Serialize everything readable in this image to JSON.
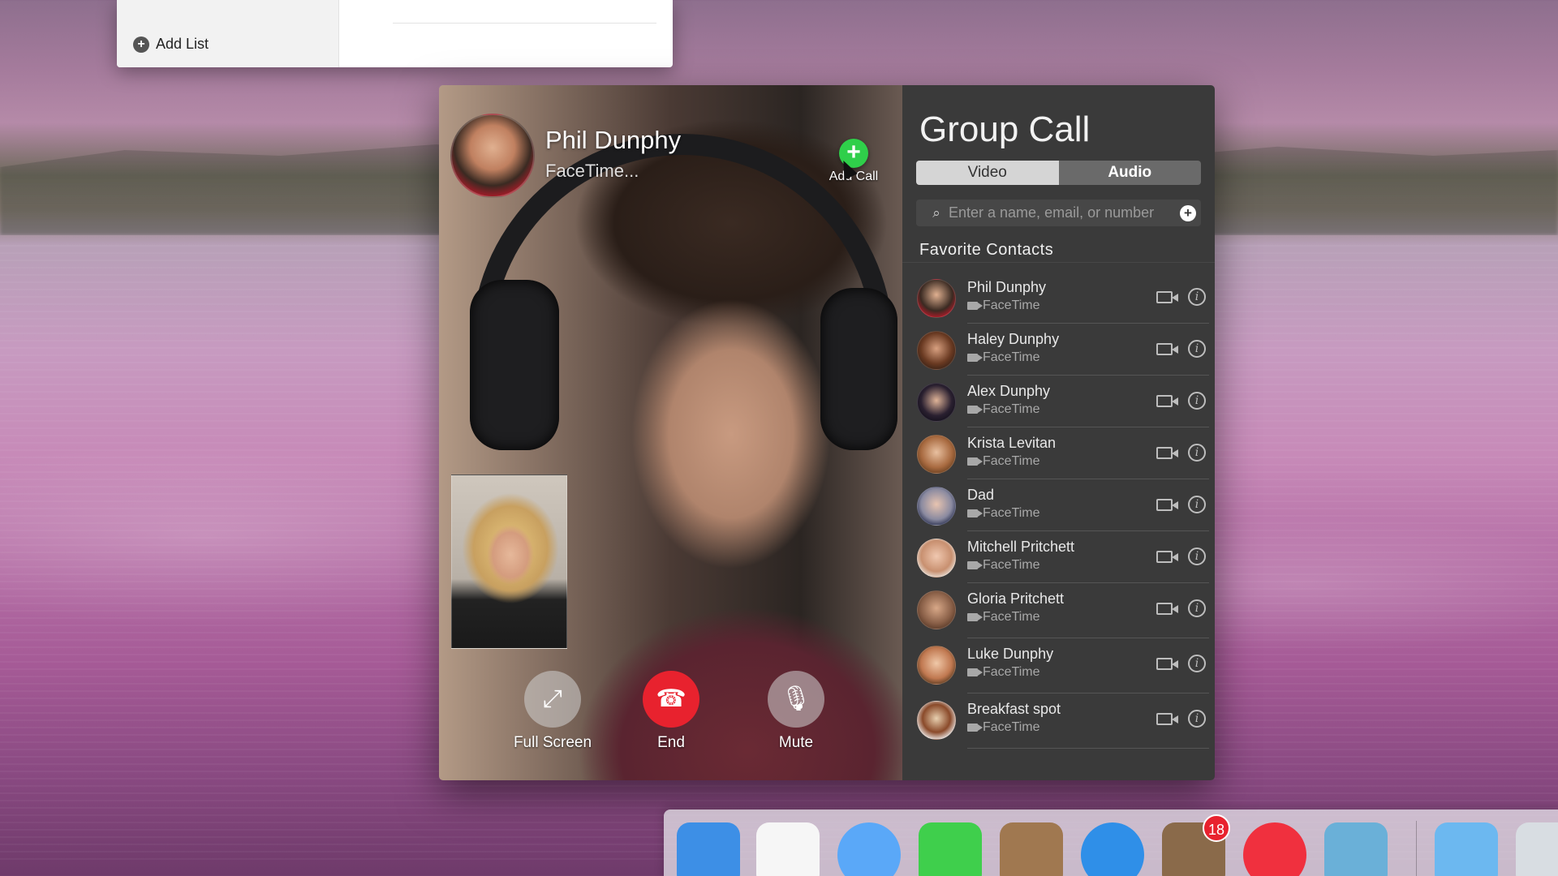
{
  "reminders": {
    "add_list_label": "Add List"
  },
  "call": {
    "caller_name": "Phil Dunphy",
    "caller_status": "FaceTime...",
    "add_call_label": "Add Call",
    "controls": {
      "fullscreen_label": "Full Screen",
      "end_label": "End",
      "mute_label": "Mute"
    }
  },
  "group_call": {
    "title": "Group Call",
    "segments": {
      "video": "Video",
      "audio": "Audio",
      "selected": "Audio"
    },
    "search_placeholder": "Enter a name, email, or number",
    "favorites_title": "Favorite Contacts",
    "contacts": [
      {
        "name": "Phil Dunphy",
        "sub": "FaceTime"
      },
      {
        "name": "Haley Dunphy",
        "sub": "FaceTime"
      },
      {
        "name": "Alex Dunphy",
        "sub": "FaceTime"
      },
      {
        "name": "Krista Levitan",
        "sub": "FaceTime"
      },
      {
        "name": "Dad",
        "sub": "FaceTime"
      },
      {
        "name": "Mitchell Pritchett",
        "sub": "FaceTime"
      },
      {
        "name": "Gloria Pritchett",
        "sub": "FaceTime"
      },
      {
        "name": "Luke Dunphy",
        "sub": "FaceTime"
      },
      {
        "name": "Breakfast spot",
        "sub": "FaceTime"
      }
    ]
  },
  "dock": {
    "items": [
      {
        "name": "finder-icon",
        "color": "#3d8fe6"
      },
      {
        "name": "reminders-icon",
        "color": "#f6f6f6"
      },
      {
        "name": "messages-icon",
        "color": "#5aa8f8"
      },
      {
        "name": "facetime-icon",
        "color": "#3fcf4c"
      },
      {
        "name": "contacts-icon",
        "color": "#a07850"
      },
      {
        "name": "safari-icon",
        "color": "#2f8fe8"
      },
      {
        "name": "mail-icon",
        "color": "#8a6a4a",
        "badge": "18"
      },
      {
        "name": "itunes-icon",
        "color": "#f0303e"
      },
      {
        "name": "photos-icon",
        "color": "#6ab0d8"
      },
      {
        "name": "folder-icon",
        "color": "#6cb8f0"
      },
      {
        "name": "trash-icon",
        "color": "#d8dde2"
      }
    ]
  }
}
